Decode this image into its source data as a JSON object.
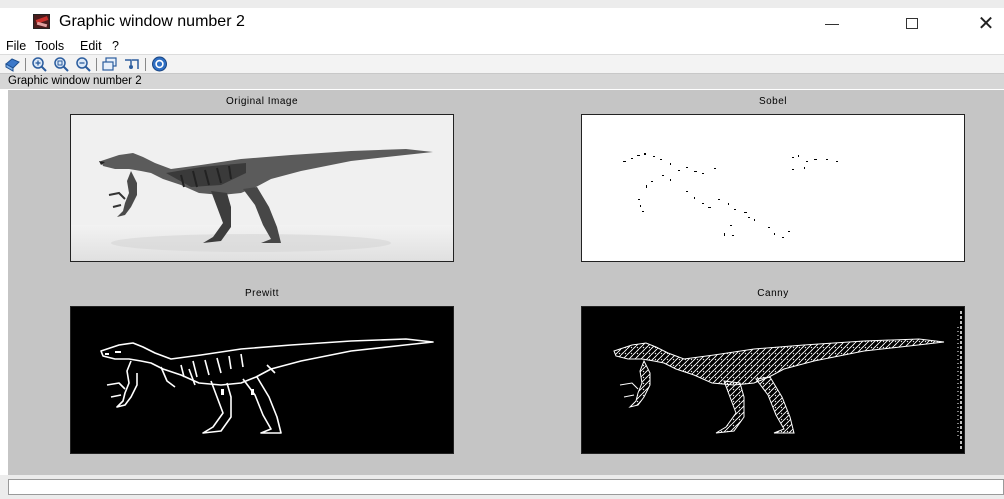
{
  "window": {
    "title": "Graphic window number 2",
    "icon": "scilab-graphic-icon",
    "controls": [
      "minimize",
      "maximize",
      "close"
    ]
  },
  "menu": {
    "items": [
      {
        "label": "File"
      },
      {
        "label": "Tools"
      },
      {
        "label": "Edit"
      },
      {
        "label": "?"
      }
    ]
  },
  "toolbar": {
    "buttons": [
      {
        "icon": "rotate-3d-icon"
      },
      {
        "icon": "zoom-in-icon"
      },
      {
        "icon": "zoom-area-icon"
      },
      {
        "icon": "zoom-out-icon"
      },
      {
        "icon": "new-window-icon"
      },
      {
        "icon": "datatip-icon"
      },
      {
        "icon": "help-icon"
      }
    ]
  },
  "status": {
    "text": "Graphic window number 2"
  },
  "plots": [
    {
      "title": "Original Image",
      "style": "grayscale"
    },
    {
      "title": "Sobel",
      "style": "sparse-edges"
    },
    {
      "title": "Prewitt",
      "style": "edge-outline"
    },
    {
      "title": "Canny",
      "style": "dense-edges"
    }
  ],
  "colors": {
    "canvas": "#c5c5c5",
    "edge_background": "#000000",
    "edge_foreground": "#ffffff"
  }
}
